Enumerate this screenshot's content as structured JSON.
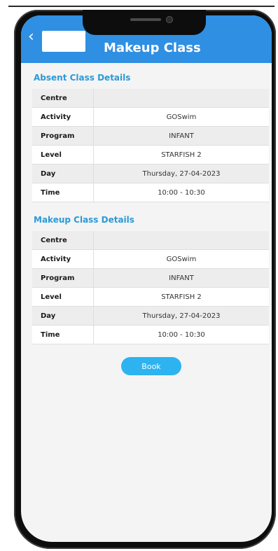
{
  "app": {
    "title": "Makeup Class",
    "back_icon": "chevron-left-icon",
    "accent_color": "#2f8fe3"
  },
  "absent_section": {
    "title": "Absent Class Details",
    "rows": [
      {
        "label": "Centre",
        "value": ""
      },
      {
        "label": "Activity",
        "value": "GOSwim"
      },
      {
        "label": "Program",
        "value": "INFANT"
      },
      {
        "label": "Level",
        "value": "STARFISH 2"
      },
      {
        "label": "Day",
        "value": "Thursday, 27-04-2023"
      },
      {
        "label": "Time",
        "value": "10:00 - 10:30"
      }
    ]
  },
  "makeup_section": {
    "title": "Makeup Class Details",
    "rows": [
      {
        "label": "Centre",
        "value": ""
      },
      {
        "label": "Activity",
        "value": "GOSwim"
      },
      {
        "label": "Program",
        "value": "INFANT"
      },
      {
        "label": "Level",
        "value": "STARFISH 2"
      },
      {
        "label": "Day",
        "value": "Thursday, 27-04-2023"
      },
      {
        "label": "Time",
        "value": "10:00 - 10:30"
      }
    ]
  },
  "actions": {
    "book_label": "Book"
  }
}
